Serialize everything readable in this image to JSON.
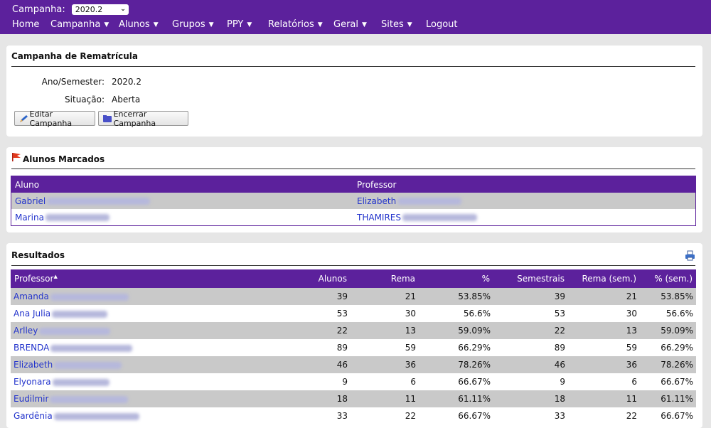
{
  "header": {
    "campaign_label": "Campanha:",
    "campaign_value": "2020.2",
    "nav": [
      {
        "label": "Home",
        "has_menu": false
      },
      {
        "label": "Campanha",
        "has_menu": true
      },
      {
        "label": "Alunos",
        "has_menu": true
      },
      {
        "label": "Grupos",
        "has_menu": true
      },
      {
        "label": "PPY",
        "has_menu": true
      },
      {
        "label": "Relatórios",
        "has_menu": true
      },
      {
        "label": "Geral",
        "has_menu": true
      },
      {
        "label": "Sites",
        "has_menu": true
      },
      {
        "label": "Logout",
        "has_menu": false
      }
    ]
  },
  "campaign_panel": {
    "title": "Campanha de Rematrícula",
    "year_label": "Ano/Semester:",
    "year_value": "2020.2",
    "status_label": "Situação:",
    "status_value": "Aberta",
    "edit_button": "Editar Campanha",
    "close_button": "Encerrar Campanha"
  },
  "marked_panel": {
    "title": "Alunos Marcados",
    "columns": [
      "Aluno",
      "Professor"
    ],
    "rows": [
      {
        "aluno": "Gabriel",
        "professor": "Elizabeth"
      },
      {
        "aluno": "Marina",
        "professor": "THAMIRES"
      }
    ]
  },
  "results_panel": {
    "title": "Resultados",
    "columns": [
      "Professor",
      "Alunos",
      "Rema",
      "%",
      "Semestrais",
      "Rema (sem.)",
      "% (sem.)"
    ],
    "sort_indicator": "▲",
    "rows": [
      {
        "professor": "Amanda",
        "alunos": "39",
        "rema": "21",
        "pct": "53.85%",
        "semestrais": "39",
        "rema_sem": "21",
        "pct_sem": "53.85%"
      },
      {
        "professor": "Ana Julia",
        "alunos": "53",
        "rema": "30",
        "pct": "56.6%",
        "semestrais": "53",
        "rema_sem": "30",
        "pct_sem": "56.6%"
      },
      {
        "professor": "Arlley",
        "alunos": "22",
        "rema": "13",
        "pct": "59.09%",
        "semestrais": "22",
        "rema_sem": "13",
        "pct_sem": "59.09%"
      },
      {
        "professor": "BRENDA",
        "alunos": "89",
        "rema": "59",
        "pct": "66.29%",
        "semestrais": "89",
        "rema_sem": "59",
        "pct_sem": "66.29%"
      },
      {
        "professor": "Elizabeth",
        "alunos": "46",
        "rema": "36",
        "pct": "78.26%",
        "semestrais": "46",
        "rema_sem": "36",
        "pct_sem": "78.26%"
      },
      {
        "professor": "Elyonara",
        "alunos": "9",
        "rema": "6",
        "pct": "66.67%",
        "semestrais": "9",
        "rema_sem": "6",
        "pct_sem": "66.67%"
      },
      {
        "professor": "Eudilmir",
        "alunos": "18",
        "rema": "11",
        "pct": "61.11%",
        "semestrais": "18",
        "rema_sem": "11",
        "pct_sem": "61.11%"
      },
      {
        "professor": "Gardênia",
        "alunos": "33",
        "rema": "22",
        "pct": "66.67%",
        "semestrais": "33",
        "rema_sem": "22",
        "pct_sem": "66.67%"
      }
    ]
  },
  "colors": {
    "brand": "#5c219c",
    "link": "#2233cc",
    "row_alt": "#c9c9c9"
  }
}
